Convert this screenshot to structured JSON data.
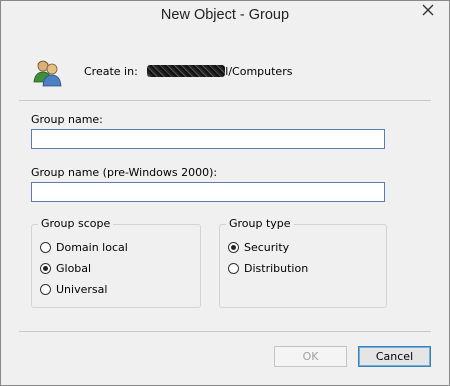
{
  "window": {
    "title": "New Object - Group"
  },
  "header": {
    "create_in_label": "Create in:",
    "create_in_path_visible": "l/Computers"
  },
  "fields": {
    "group_name_label": "Group name:",
    "group_name_value": "",
    "group_name_pre2000_label": "Group name (pre-Windows 2000):",
    "group_name_pre2000_value": ""
  },
  "group_scope": {
    "legend": "Group scope",
    "options": [
      {
        "label": "Domain local",
        "checked": false
      },
      {
        "label": "Global",
        "checked": true
      },
      {
        "label": "Universal",
        "checked": false
      }
    ]
  },
  "group_type": {
    "legend": "Group type",
    "options": [
      {
        "label": "Security",
        "checked": true
      },
      {
        "label": "Distribution",
        "checked": false
      }
    ]
  },
  "buttons": {
    "ok": "OK",
    "cancel": "Cancel"
  },
  "icons": {
    "title_close": "close-icon",
    "header": "users-group-icon"
  },
  "colors": {
    "window_bg": "#f0f0f0",
    "textbox_border": "#5a7ea8",
    "default_button_border": "#3c7fb1"
  }
}
